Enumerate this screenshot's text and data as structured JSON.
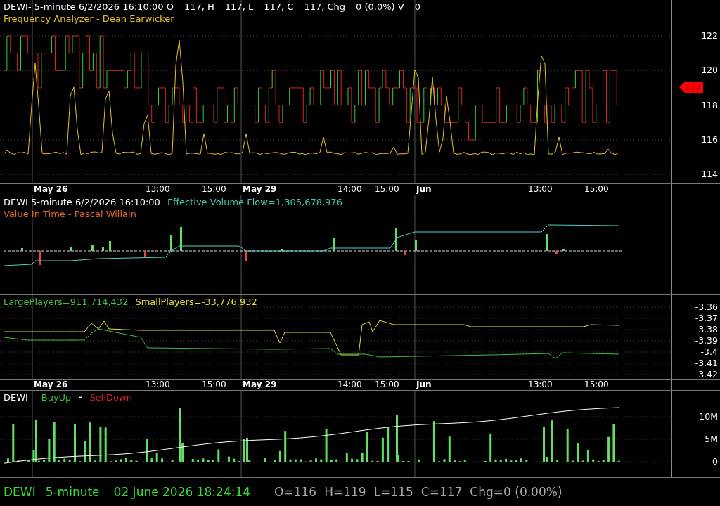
{
  "panels": [
    {
      "kind": "price",
      "legend": [
        [
          {
            "text": "DEWI- 5-minute 6/2/2026 16:10:00 O= 117, H= 117, L= 117, C= 117, Chg= 0 (0.0%) V= 0",
            "color": "#ffffff"
          }
        ],
        [
          {
            "text": "Frequency Analyzer - Dean Earwicker",
            "color": "#e8c020"
          }
        ]
      ],
      "ticks": [
        "122",
        "120",
        "118",
        "116",
        "114"
      ],
      "price_tag": "117"
    },
    {
      "kind": "flow",
      "legend": [
        [
          {
            "text": "DEWI 5-minute  6/2/2026 16:10:00",
            "color": "#ffffff"
          },
          {
            "text": "Effective Volume Flow=1,305,678,976",
            "color": "#40c8b0"
          }
        ],
        [
          {
            "text": "Value In Time - Pascal Willain",
            "color": "#e06828"
          }
        ]
      ]
    },
    {
      "kind": "players",
      "legend": [
        [
          {
            "text": "LargePlayers=911,714,432",
            "color": "#40c040"
          },
          {
            "text": "SmallPlayers=-33,776,932",
            "color": "#e8e030"
          }
        ]
      ],
      "ticks": [
        "-3.36",
        "-3.37",
        "-3.38",
        "-3.39",
        "-3.4",
        "-3.41",
        "-3.42"
      ]
    },
    {
      "kind": "volume",
      "legend": [
        [
          {
            "text": "DEWI -",
            "color": "#ffffff"
          },
          {
            "text": "BuyUp",
            "color": "#40c040"
          },
          {
            "text": "-",
            "color": "#ffffff"
          },
          {
            "text": "SellDown",
            "color": "#e02020"
          }
        ]
      ],
      "ticks": [
        "10M",
        "5M",
        "0"
      ]
    }
  ],
  "date_axes": [
    [
      {
        "text": "May 26",
        "kind": "day"
      },
      {
        "text": "13:00",
        "kind": "time"
      },
      {
        "text": "15:00",
        "kind": "time"
      },
      {
        "text": "May 29",
        "kind": "day"
      },
      {
        "text": "14:00",
        "kind": "time"
      },
      {
        "text": "15:00",
        "kind": "time"
      },
      {
        "text": "Jun",
        "kind": "day"
      },
      {
        "text": "13:00",
        "kind": "time"
      },
      {
        "text": "15:00",
        "kind": "time"
      }
    ],
    [
      {
        "text": "May 26",
        "kind": "day"
      },
      {
        "text": "13:00",
        "kind": "time"
      },
      {
        "text": "15:00",
        "kind": "time"
      },
      {
        "text": "May 29",
        "kind": "day"
      },
      {
        "text": "14:00",
        "kind": "time"
      },
      {
        "text": "15:00",
        "kind": "time"
      },
      {
        "text": "Jun",
        "kind": "day"
      },
      {
        "text": "13:00",
        "kind": "time"
      },
      {
        "text": "15:00",
        "kind": "time"
      }
    ]
  ],
  "status_bar": {
    "symbol": "DEWI",
    "interval": "5-minute",
    "datetime": "02 June 2026 18:24:14",
    "quote": [
      "O=116",
      "H=119",
      "L=115",
      "C=117",
      "Chg=0 (0.00%)"
    ]
  }
}
